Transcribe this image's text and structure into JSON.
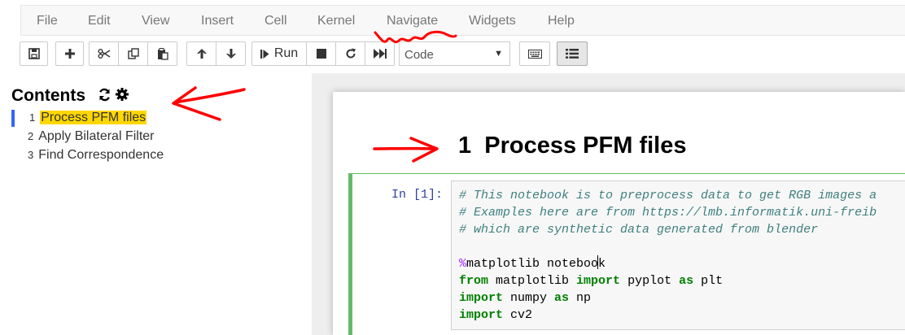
{
  "menubar": {
    "items": [
      "File",
      "Edit",
      "View",
      "Insert",
      "Cell",
      "Kernel",
      "Navigate",
      "Widgets",
      "Help"
    ]
  },
  "toolbar": {
    "icons": {
      "save": "save-icon",
      "insert": "plus-icon",
      "cut": "scissors-icon",
      "copy": "copy-icon",
      "paste": "paste-icon",
      "move_up": "arrow-up-icon",
      "move_down": "arrow-down-icon",
      "run": "step-forward-icon",
      "interrupt": "stop-icon",
      "restart": "redo-icon",
      "restart_run_all": "fast-forward-icon",
      "command_palette": "keyboard-icon",
      "toc": "list-icon"
    },
    "run_label": "Run",
    "cell_type": "Code"
  },
  "toc": {
    "title": "Contents",
    "icons": [
      "refresh-icon",
      "gear-icon"
    ],
    "items": [
      {
        "num": "1",
        "label": "Process PFM files",
        "active": true
      },
      {
        "num": "2",
        "label": "Apply Bilateral Filter",
        "active": false
      },
      {
        "num": "3",
        "label": "Find Correspondence",
        "active": false
      }
    ]
  },
  "notebook": {
    "heading_num": "1",
    "heading": "Process PFM files",
    "cell": {
      "prompt": "In [1]:",
      "lines": [
        "# This notebook is to preprocess data to get RGB images a",
        "# Examples here are from https://lmb.informatik.uni-freib",
        "# which are synthetic data generated from blender",
        "",
        "%matplotlib notebook",
        "from matplotlib import pyplot as plt",
        "import numpy as np",
        "import cv2"
      ]
    }
  },
  "colors": {
    "accent_active": "#3366ff",
    "toc_highlight": "#ffd700",
    "cell_border": "#66bb6a",
    "annotation": "#ff0000"
  }
}
